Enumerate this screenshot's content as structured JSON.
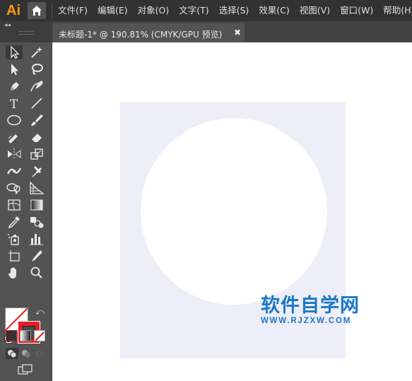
{
  "app": {
    "logo_text": "Ai"
  },
  "menu": [
    "文件(F)",
    "编辑(E)",
    "对象(O)",
    "文字(T)",
    "选择(S)",
    "效果(C)",
    "视图(V)",
    "窗口(W)",
    "帮助(H)"
  ],
  "document_tab": {
    "title": "未标题-1* @ 190.81% (CMYK/GPU 预览)",
    "close": "✖"
  },
  "toolbar": {
    "collapse": "◂◂",
    "tools": [
      "selection-tool",
      "magic-wand-tool",
      "direct-selection-tool",
      "lasso-tool",
      "pen-tool",
      "curvature-tool",
      "type-tool",
      "line-segment-tool",
      "ellipse-tool",
      "paintbrush-tool",
      "pencil-tool",
      "eraser-tool",
      "reflect-tool",
      "scale-tool",
      "width-tool",
      "puppet-warp-tool",
      "shape-builder-tool",
      "perspective-grid-tool",
      "mesh-tool",
      "gradient-tool",
      "eyedropper-tool",
      "blend-tool",
      "symbol-sprayer-tool",
      "column-graph-tool",
      "artboard-tool",
      "slice-tool",
      "hand-tool",
      "zoom-tool"
    ],
    "fill_color": "none",
    "stroke_color": "#e31e24"
  },
  "canvas": {
    "background": "#ffffff",
    "artboard_color": "#eeeef8",
    "circle_color": "#ffffff"
  },
  "watermark": {
    "main": "软件自学网",
    "sub": "WWW.RJZXW.COM",
    "color": "#1a78c8"
  }
}
